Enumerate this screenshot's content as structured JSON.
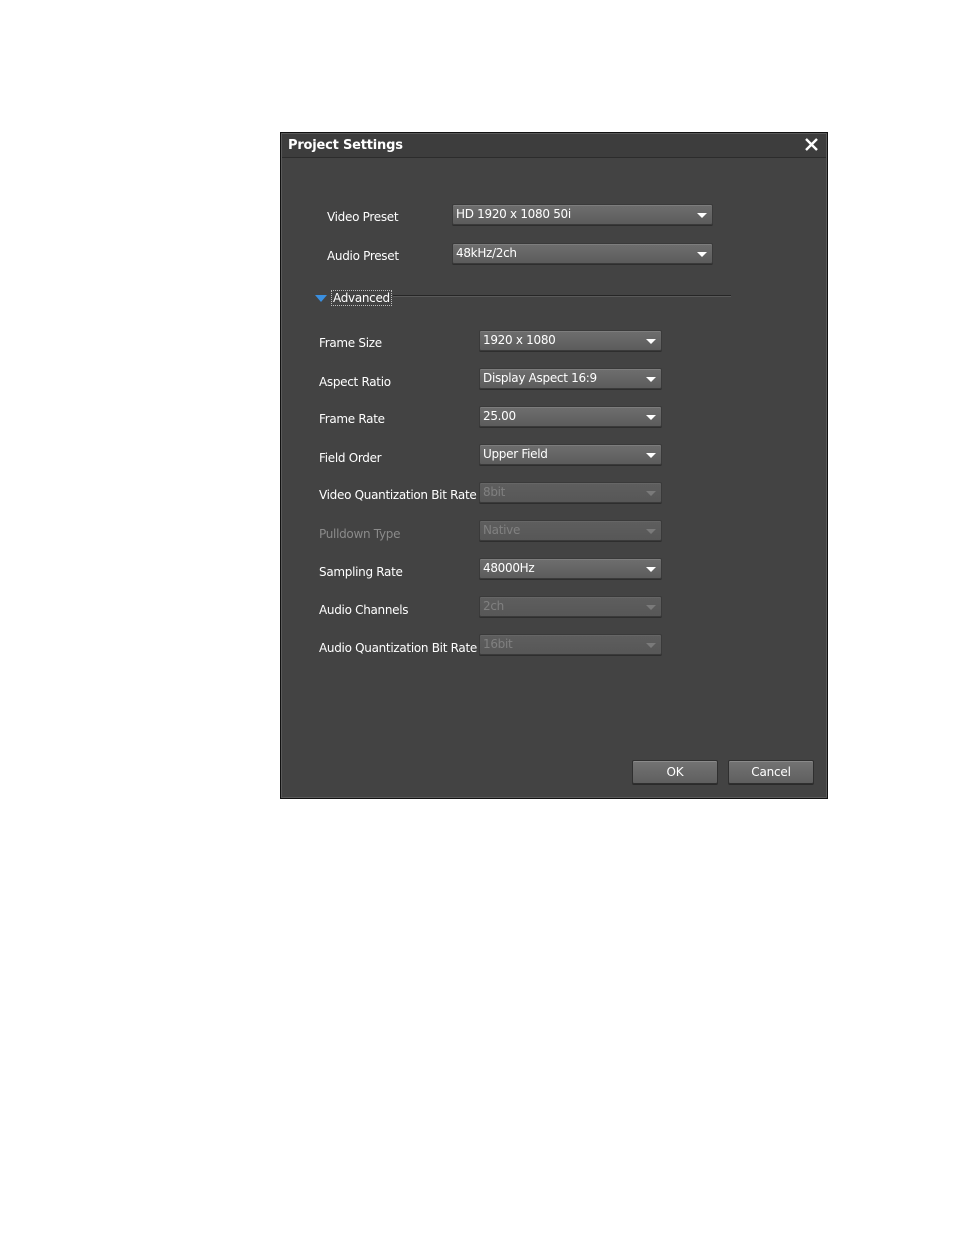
{
  "dialog": {
    "title": "Project Settings",
    "close_icon": "close-icon"
  },
  "presets": {
    "video": {
      "label": "Video Preset",
      "value": "HD 1920 x 1080 50i"
    },
    "audio": {
      "label": "Audio Preset",
      "value": "48kHz/2ch"
    }
  },
  "advanced": {
    "label": "Advanced",
    "expanded": true,
    "toggle_icon": "triangle-down-icon",
    "accent_color": "#3a8fe0"
  },
  "settings": {
    "frame_size": {
      "label": "Frame Size",
      "value": "1920 x 1080",
      "enabled": true
    },
    "aspect_ratio": {
      "label": "Aspect Ratio",
      "value": "Display Aspect 16:9",
      "enabled": true
    },
    "frame_rate": {
      "label": "Frame Rate",
      "value": "25.00",
      "enabled": true
    },
    "field_order": {
      "label": "Field Order",
      "value": "Upper Field",
      "enabled": true
    },
    "video_quant": {
      "label": "Video Quantization Bit Rate",
      "value": "8bit",
      "enabled": false
    },
    "pulldown": {
      "label": "Pulldown Type",
      "value": "Native",
      "enabled": false
    },
    "sampling_rate": {
      "label": "Sampling Rate",
      "value": "48000Hz",
      "enabled": true
    },
    "audio_channels": {
      "label": "Audio Channels",
      "value": "2ch",
      "enabled": false
    },
    "audio_quant": {
      "label": "Audio Quantization Bit Rate",
      "value": "16bit",
      "enabled": false
    }
  },
  "buttons": {
    "ok": "OK",
    "cancel": "Cancel"
  }
}
